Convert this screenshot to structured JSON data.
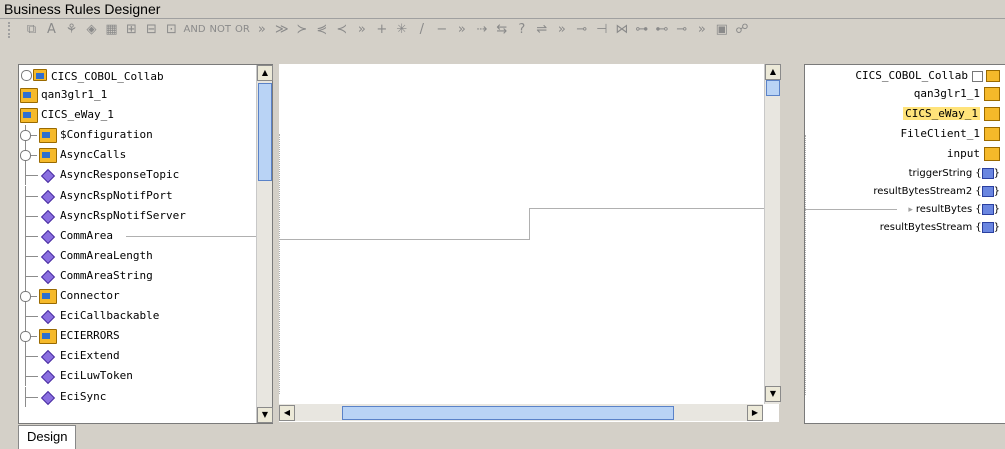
{
  "window": {
    "title": "Business Rules Designer"
  },
  "toolbar": {
    "items": [
      "⧉",
      "A",
      "⚘",
      "◈",
      "▦",
      "⊞",
      "⊟",
      "⊡",
      "AND",
      "NOT",
      "OR",
      "»",
      "≫",
      "≻",
      "⋞",
      "≺",
      "»",
      "+",
      "✳",
      "/",
      "−",
      "»",
      "⇢",
      "⇆",
      "?",
      "⇌",
      "»",
      "⊸",
      "⊣",
      "⋈",
      "⊶",
      "⊷",
      "⊸",
      "»",
      "▣",
      "☍"
    ]
  },
  "left_tree": {
    "root": "CICS_COBOL_Collab",
    "items": [
      {
        "label": "qan3glr1_1",
        "kind": "folder",
        "level": 0
      },
      {
        "label": "CICS_eWay_1",
        "kind": "folder",
        "level": 0
      },
      {
        "label": "$Configuration",
        "kind": "folder",
        "level": 1
      },
      {
        "label": "AsyncCalls",
        "kind": "folder",
        "level": 1
      },
      {
        "label": "AsyncResponseTopic",
        "kind": "field",
        "level": 1
      },
      {
        "label": "AsyncRspNotifPort",
        "kind": "field",
        "level": 1
      },
      {
        "label": "AsyncRspNotifServer",
        "kind": "field",
        "level": 1
      },
      {
        "label": "CommArea",
        "kind": "field",
        "level": 1
      },
      {
        "label": "CommAreaLength",
        "kind": "field",
        "level": 1
      },
      {
        "label": "CommAreaString",
        "kind": "field",
        "level": 1
      },
      {
        "label": "Connector",
        "kind": "folder",
        "level": 1
      },
      {
        "label": "EciCallbackable",
        "kind": "field",
        "level": 1
      },
      {
        "label": "ECIERRORS",
        "kind": "folder",
        "level": 1
      },
      {
        "label": "EciExtend",
        "kind": "field",
        "level": 1
      },
      {
        "label": "EciLuwToken",
        "kind": "field",
        "level": 1
      },
      {
        "label": "EciSync",
        "kind": "field",
        "level": 1
      }
    ]
  },
  "right_tree": {
    "root": "CICS_COBOL_Collab",
    "items": [
      {
        "label": "qan3glr1_1",
        "kind": "folder"
      },
      {
        "label": "CICS_eWay_1",
        "kind": "folder",
        "selected": true
      },
      {
        "label": "FileClient_1",
        "kind": "folder"
      },
      {
        "label": "input",
        "kind": "folder"
      },
      {
        "label": "triggerString",
        "kind": "field"
      },
      {
        "label": "resultBytesStream2",
        "kind": "field"
      },
      {
        "label": "resultBytes",
        "kind": "field",
        "mapped": true
      },
      {
        "label": "resultBytesStream",
        "kind": "field"
      }
    ]
  },
  "tabs": {
    "design": "Design"
  },
  "colors": {
    "background": "#d4d0c8",
    "highlight": "#ffe37a",
    "accent": "#5a82c8"
  }
}
